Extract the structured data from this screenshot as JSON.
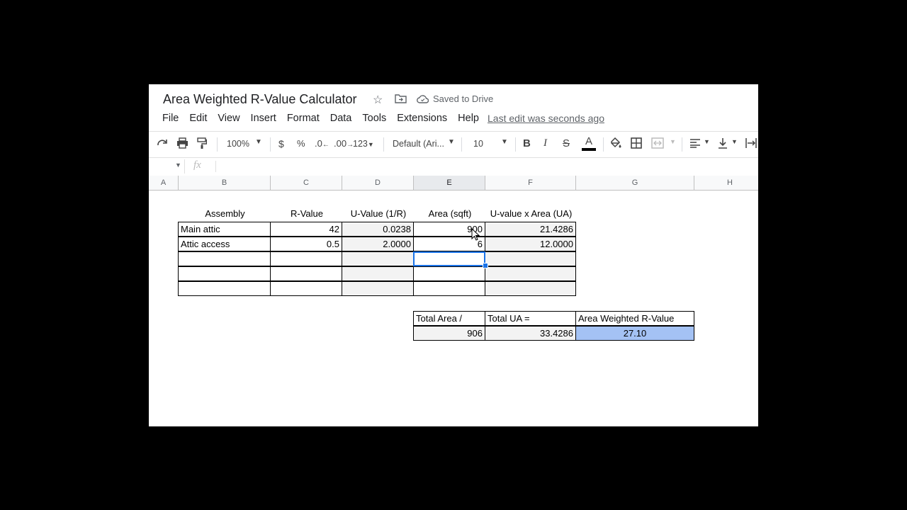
{
  "doc": {
    "title": "Area Weighted R-Value Calculator",
    "saved_status": "Saved to Drive",
    "last_edit": "Last edit was seconds ago"
  },
  "menu": [
    "File",
    "Edit",
    "View",
    "Insert",
    "Format",
    "Data",
    "Tools",
    "Extensions",
    "Help"
  ],
  "toolbar": {
    "zoom": "100%",
    "currency": "$",
    "percent": "%",
    "dec_less": ".0",
    "dec_more": ".00",
    "more_formats": "123",
    "font": "Default (Ari...",
    "font_size": "10",
    "bold": "B",
    "italic": "I",
    "strike": "S",
    "text_color": "A"
  },
  "formula_bar": {
    "fx": "fx"
  },
  "columns": [
    "A",
    "B",
    "C",
    "D",
    "E",
    "F",
    "G",
    "H"
  ],
  "table": {
    "headers": [
      "Assembly",
      "R-Value",
      "U-Value (1/R)",
      "Area (sqft)",
      "U-value x Area (UA)"
    ],
    "rows": [
      [
        "Main attic",
        "42",
        "0.0238",
        "900",
        "21.4286"
      ],
      [
        "Attic access",
        "0.5",
        "2.0000",
        "6",
        "12.0000"
      ],
      [
        "",
        "",
        "",
        "",
        ""
      ],
      [
        "",
        "",
        "",
        "",
        ""
      ],
      [
        "",
        "",
        "",
        "",
        ""
      ]
    ]
  },
  "summary": {
    "headers": [
      "Total Area /",
      "Total UA =",
      "Area Weighted R-Value"
    ],
    "values": [
      "906",
      "33.4286",
      "27.10"
    ]
  },
  "colors": {
    "accent": "#1a73e8",
    "result_fill": "#a4c2f4",
    "calc_fill": "#f3f3f3"
  }
}
